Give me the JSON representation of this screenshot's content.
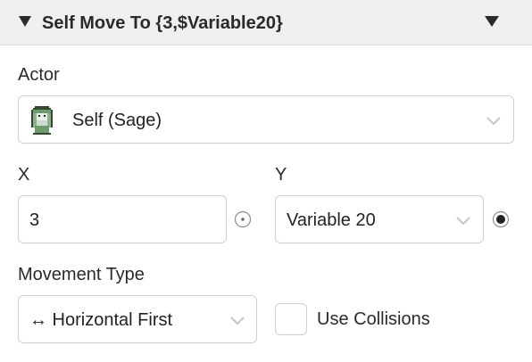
{
  "header": {
    "title": "Self Move To {3,$Variable20}",
    "collapse_icon": "triangle-down-icon",
    "menu_icon": "triangle-down-icon"
  },
  "actor": {
    "label": "Actor",
    "value": "Self (Sage)",
    "sprite_icon": "sage-sprite-icon"
  },
  "x": {
    "label": "X",
    "value": "3"
  },
  "y": {
    "label": "Y",
    "value": "Variable 20"
  },
  "movement_type": {
    "label": "Movement Type",
    "value": "↔ Horizontal First"
  },
  "use_collisions": {
    "label": "Use Collisions",
    "checked": false
  },
  "colors": {
    "header_bg": "#efefef",
    "border": "#cfcfcf",
    "text": "#222222"
  }
}
